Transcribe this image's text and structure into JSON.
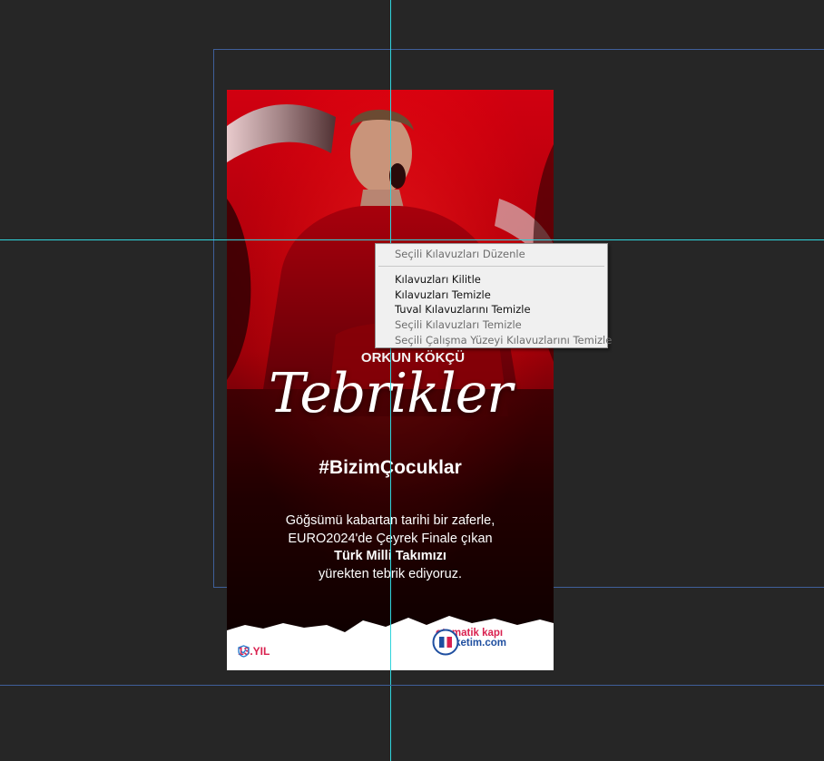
{
  "poster": {
    "title": "Tebrikler",
    "hashtag": "#BizimÇocuklar",
    "body_lines": [
      "Göğsümü kabartan tarihi bir zaferle,",
      "EURO2024'de Çeyrek Finale çıkan",
      "Türk Milli Takımızı",
      "yürekten tebrik ediyoruz."
    ],
    "jersey_text": "ORKUN KÖKÇÜ",
    "year_badge": "13.YIL",
    "brand": {
      "line1": "otomatik kapı",
      "line2": "marketim.com"
    },
    "colors": {
      "red": "#c3000f",
      "dark": "#120000",
      "brand_blue": "#1f4fa0",
      "brand_pink": "#d9214f"
    }
  },
  "context_menu": {
    "items": [
      {
        "label": "Seçili Kılavuzları Düzenle",
        "enabled": false
      },
      {
        "label": "Kılavuzları Kilitle",
        "enabled": true
      },
      {
        "label": "Kılavuzları Temizle",
        "enabled": true
      },
      {
        "label": "Tuval Kılavuzlarını Temizle",
        "enabled": true
      },
      {
        "label": "Seçili Kılavuzları Temizle",
        "enabled": false
      },
      {
        "label": "Seçili Çalışma Yüzeyi Kılavuzlarını Temizle",
        "enabled": false
      }
    ]
  },
  "icons": {
    "shield": "shield-check-icon",
    "brand_logo": "door-logo-icon"
  }
}
